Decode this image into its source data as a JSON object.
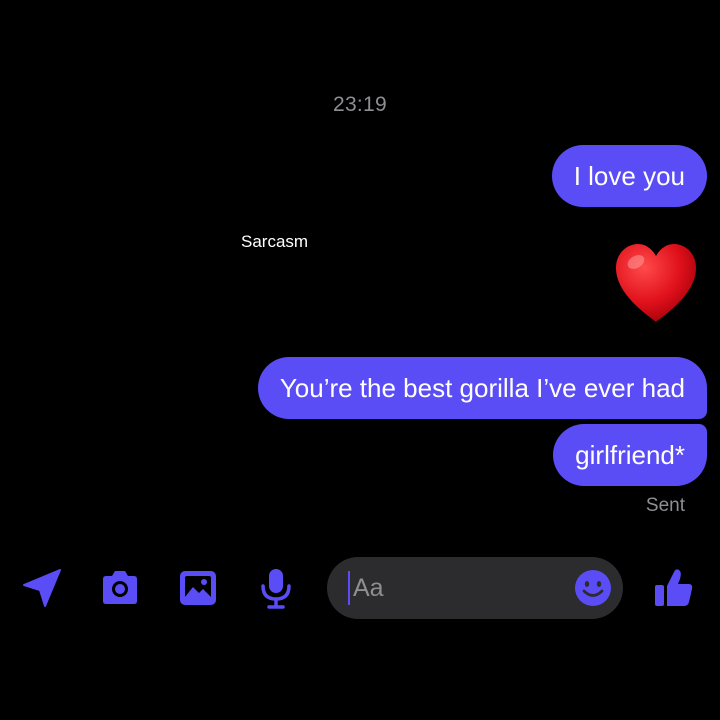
{
  "conversation": {
    "timestamp": "23:19",
    "caption": "Sarcasm",
    "messages": [
      {
        "text": "I love you"
      },
      {
        "text": "You’re the best gorilla I’ve ever had"
      },
      {
        "text": "girlfriend*"
      }
    ],
    "reaction_icon": "red-heart-icon",
    "status": "Sent"
  },
  "composer": {
    "placeholder": "Aa",
    "icons": [
      "location-arrow-icon",
      "camera-icon",
      "gallery-icon",
      "microphone-icon",
      "smiley-icon",
      "thumbs-up-icon"
    ]
  },
  "colors": {
    "background": "#000000",
    "accent": "#5b4df6",
    "bubble_text": "#ffffff",
    "muted_text": "#8e8e93",
    "input_background": "#2c2c2e",
    "heart": "#e0111b"
  }
}
